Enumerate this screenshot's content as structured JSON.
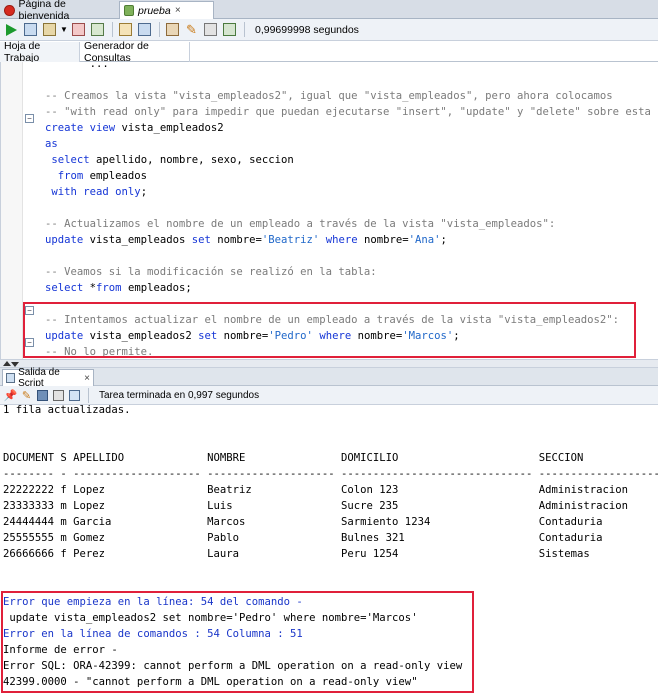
{
  "tabs": [
    {
      "label": "Página de bienvenida"
    },
    {
      "label": "prueba"
    }
  ],
  "toolbar": {
    "elapsed": "0,99699998 segundos"
  },
  "subtabs": [
    "Hoja de Trabajo",
    "Generador de Consultas"
  ],
  "editor": {
    "lines": [
      {
        "type": "cut",
        "text": "       ...         "
      },
      {
        "type": "blank",
        "text": ""
      },
      {
        "type": "comment",
        "text": "-- Creamos la vista \"vista_empleados2\", igual que \"vista_empleados\", pero ahora colocamos"
      },
      {
        "type": "comment",
        "text": "-- \"with read only\" para impedir que puedan ejecutarse \"insert\", \"update\" y \"delete\" sobre esta"
      },
      {
        "type": "code",
        "html_key": "l4"
      },
      {
        "type": "code",
        "html_key": "l5"
      },
      {
        "type": "code",
        "html_key": "l6"
      },
      {
        "type": "code",
        "html_key": "l7"
      },
      {
        "type": "code",
        "html_key": "l8"
      },
      {
        "type": "blank",
        "text": ""
      },
      {
        "type": "comment",
        "text": "-- Actualizamos el nombre de un empleado a través de la vista \"vista_empleados\":"
      },
      {
        "type": "code",
        "html_key": "l11"
      },
      {
        "type": "blank",
        "text": ""
      },
      {
        "type": "comment",
        "text": "-- Veamos si la modificación se realizó en la tabla:"
      },
      {
        "type": "code",
        "html_key": "l14"
      },
      {
        "type": "blank",
        "text": ""
      },
      {
        "type": "comment",
        "text": "-- Intentamos actualizar el nombre de un empleado a través de la vista \"vista_empleados2\":"
      },
      {
        "type": "code",
        "html_key": "l17"
      },
      {
        "type": "comment",
        "text": "-- No lo permite."
      }
    ],
    "tokens": {
      "l4": [
        [
          "kw",
          "create view"
        ],
        [
          "pl",
          " vista_empleados2"
        ]
      ],
      "l5": [
        [
          "kw",
          "as"
        ]
      ],
      "l6": [
        [
          "pl",
          " "
        ],
        [
          "kw",
          "select"
        ],
        [
          "pl",
          " apellido, nombre, sexo, seccion"
        ]
      ],
      "l7": [
        [
          "pl",
          "  "
        ],
        [
          "kw",
          "from"
        ],
        [
          "pl",
          " empleados"
        ]
      ],
      "l8": [
        [
          "pl",
          " "
        ],
        [
          "kw",
          "with read only"
        ],
        [
          "pl",
          ";"
        ]
      ],
      "l11": [
        [
          "kw",
          "update"
        ],
        [
          "pl",
          " vista_empleados "
        ],
        [
          "kw",
          "set"
        ],
        [
          "pl",
          " nombre="
        ],
        [
          "str",
          "'Beatriz'"
        ],
        [
          "pl",
          " "
        ],
        [
          "kw",
          "where"
        ],
        [
          "pl",
          " nombre="
        ],
        [
          "str",
          "'Ana'"
        ],
        [
          "pl",
          ";"
        ]
      ],
      "l14": [
        [
          "kw",
          "select"
        ],
        [
          "pl",
          " *"
        ],
        [
          "kw",
          "from"
        ],
        [
          "pl",
          " empleados;"
        ]
      ],
      "l17": [
        [
          "kw",
          "update"
        ],
        [
          "pl",
          " vista_empleados2 "
        ],
        [
          "kw",
          "set"
        ],
        [
          "pl",
          " nombre="
        ],
        [
          "str",
          "'Pedro'"
        ],
        [
          "pl",
          " "
        ],
        [
          "kw",
          "where"
        ],
        [
          "pl",
          " nombre="
        ],
        [
          "str",
          "'Marcos'"
        ],
        [
          "pl",
          ";"
        ]
      ]
    }
  },
  "output_tab": {
    "label": "Salida de Script",
    "task_status": "Tarea terminada en 0,997 segundos"
  },
  "output": {
    "lines": [
      {
        "cls": "",
        "text": "1 fila actualizadas."
      },
      {
        "cls": "",
        "text": ""
      },
      {
        "cls": "",
        "text": ""
      },
      {
        "cls": "",
        "text": "DOCUMENT S APELLIDO             NOMBRE               DOMICILIO                      SECCION"
      },
      {
        "cls": "",
        "text": "-------- - -------------------- -------------------- ------------------------------ --------------------"
      },
      {
        "cls": "",
        "text": "22222222 f Lopez                Beatriz              Colon 123                      Administracion"
      },
      {
        "cls": "",
        "text": "23333333 m Lopez                Luis                 Sucre 235                      Administracion"
      },
      {
        "cls": "",
        "text": "24444444 m Garcia               Marcos               Sarmiento 1234                 Contaduria"
      },
      {
        "cls": "",
        "text": "25555555 m Gomez                Pablo                Bulnes 321                     Contaduria"
      },
      {
        "cls": "",
        "text": "26666666 f Perez                Laura                Peru 1254                      Sistemas"
      },
      {
        "cls": "",
        "text": ""
      },
      {
        "cls": "",
        "text": ""
      },
      {
        "cls": "err",
        "text": "Error que empieza en la línea: 54 del comando -"
      },
      {
        "cls": "",
        "text": " update vista_empleados2 set nombre='Pedro' where nombre='Marcos'"
      },
      {
        "cls": "err",
        "text": "Error en la línea de comandos : 54 Columna : 51"
      },
      {
        "cls": "",
        "text": "Informe de error -"
      },
      {
        "cls": "",
        "text": "Error SQL: ORA-42399: cannot perform a DML operation on a read-only view"
      },
      {
        "cls": "",
        "text": "42399.0000 - \"cannot perform a DML operation on a read-only view\""
      }
    ]
  }
}
